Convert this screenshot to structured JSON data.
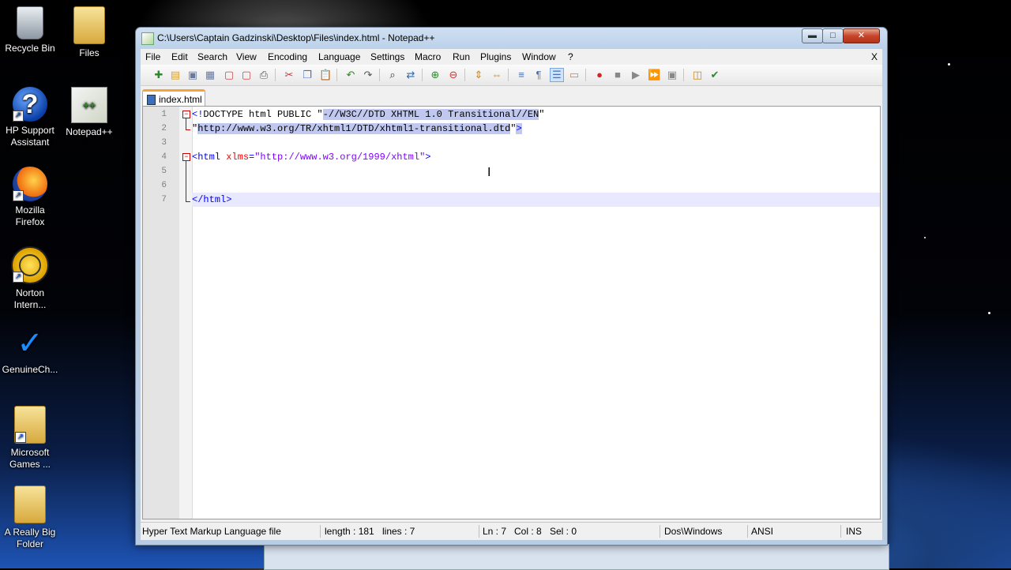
{
  "desktop": {
    "icons": [
      {
        "label": "Recycle Bin"
      },
      {
        "label": "Files"
      },
      {
        "label": "HP Support Assistant"
      },
      {
        "label": "Notepad++"
      },
      {
        "label": "Mozilla Firefox"
      },
      {
        "label": "Norton Intern..."
      },
      {
        "label": "GenuineCh..."
      },
      {
        "label": "Microsoft Games ..."
      },
      {
        "label": "A Really Big Folder"
      }
    ]
  },
  "window": {
    "title": "C:\\Users\\Captain Gadzinski\\Desktop\\Files\\index.html - Notepad++",
    "controls": {
      "minimize": "▬",
      "maximize": "□",
      "close": "✕"
    }
  },
  "menu": {
    "items": [
      "File",
      "Edit",
      "Search",
      "View",
      "Encoding",
      "Language",
      "Settings",
      "Macro",
      "Run",
      "Plugins",
      "Window",
      "?"
    ],
    "close": "X"
  },
  "toolbar": {
    "icons": [
      "new-file-icon",
      "open-file-icon",
      "save-icon",
      "save-all-icon",
      "close-icon",
      "close-all-icon",
      "print-icon",
      "cut-icon",
      "copy-icon",
      "paste-icon",
      "undo-icon",
      "redo-icon",
      "find-icon",
      "replace-icon",
      "zoom-in-icon",
      "zoom-out-icon",
      "sync-v-icon",
      "sync-h-icon",
      "word-wrap-icon",
      "show-all-chars-icon",
      "indent-guide-icon",
      "user-lang-icon",
      "record-macro-icon",
      "stop-macro-icon",
      "play-macro-icon",
      "run-macro-multiple-icon",
      "save-macro-icon",
      "spell-check-icon",
      "monitor-icon"
    ]
  },
  "tabs": [
    {
      "label": "index.html"
    }
  ],
  "editor": {
    "lines": [
      {
        "num": "1",
        "parts": [
          [
            "t-tag",
            "<!"
          ],
          [
            "t-doc",
            "DOCTYPE html PUBLIC \""
          ],
          [
            "t-doc sel",
            "-//W3C//DTD XHTML 1.0 Transitional//EN"
          ],
          [
            "t-doc",
            "\""
          ]
        ]
      },
      {
        "num": "2",
        "parts": [
          [
            "t-doc",
            "\""
          ],
          [
            "t-doc sel",
            "http://www.w3.org/TR/xhtml1/DTD/xhtml1-transitional.dtd"
          ],
          [
            "t-doc",
            "\""
          ],
          [
            "t-tag sel",
            ">"
          ]
        ]
      },
      {
        "num": "3",
        "parts": []
      },
      {
        "num": "4",
        "parts": [
          [
            "t-tag",
            "<html "
          ],
          [
            "t-attr",
            "xlms"
          ],
          [
            "t-tag",
            "="
          ],
          [
            "t-str",
            "\"http://www.w3.org/1999/xhtml\""
          ],
          [
            "t-tag",
            ">"
          ]
        ]
      },
      {
        "num": "5",
        "parts": []
      },
      {
        "num": "6",
        "parts": []
      },
      {
        "num": "7",
        "parts": [
          [
            "t-tag",
            "</html>"
          ]
        ]
      }
    ],
    "current_line": 7
  },
  "status": {
    "file_type": "Hyper Text Markup Language file",
    "length": "length : 181",
    "lines": "lines : 7",
    "ln": "Ln : 7",
    "col": "Col : 8",
    "sel": "Sel : 0",
    "eol": "Dos\\Windows",
    "encoding": "ANSI",
    "mode": "INS"
  }
}
